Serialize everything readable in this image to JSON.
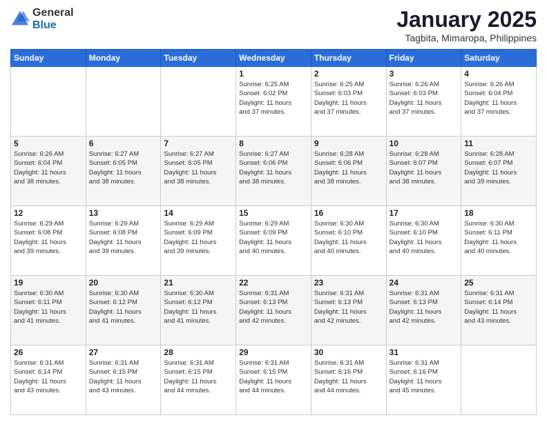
{
  "logo": {
    "general": "General",
    "blue": "Blue"
  },
  "header": {
    "title": "January 2025",
    "subtitle": "Tagbita, Mimaropa, Philippines"
  },
  "weekdays": [
    "Sunday",
    "Monday",
    "Tuesday",
    "Wednesday",
    "Thursday",
    "Friday",
    "Saturday"
  ],
  "weeks": [
    [
      {
        "day": "",
        "info": ""
      },
      {
        "day": "",
        "info": ""
      },
      {
        "day": "",
        "info": ""
      },
      {
        "day": "1",
        "info": "Sunrise: 6:25 AM\nSunset: 6:02 PM\nDaylight: 11 hours\nand 37 minutes."
      },
      {
        "day": "2",
        "info": "Sunrise: 6:25 AM\nSunset: 6:03 PM\nDaylight: 11 hours\nand 37 minutes."
      },
      {
        "day": "3",
        "info": "Sunrise: 6:26 AM\nSunset: 6:03 PM\nDaylight: 11 hours\nand 37 minutes."
      },
      {
        "day": "4",
        "info": "Sunrise: 6:26 AM\nSunset: 6:04 PM\nDaylight: 11 hours\nand 37 minutes."
      }
    ],
    [
      {
        "day": "5",
        "info": "Sunrise: 6:26 AM\nSunset: 6:04 PM\nDaylight: 11 hours\nand 38 minutes."
      },
      {
        "day": "6",
        "info": "Sunrise: 6:27 AM\nSunset: 6:05 PM\nDaylight: 11 hours\nand 38 minutes."
      },
      {
        "day": "7",
        "info": "Sunrise: 6:27 AM\nSunset: 6:05 PM\nDaylight: 11 hours\nand 38 minutes."
      },
      {
        "day": "8",
        "info": "Sunrise: 6:27 AM\nSunset: 6:06 PM\nDaylight: 11 hours\nand 38 minutes."
      },
      {
        "day": "9",
        "info": "Sunrise: 6:28 AM\nSunset: 6:06 PM\nDaylight: 11 hours\nand 38 minutes."
      },
      {
        "day": "10",
        "info": "Sunrise: 6:28 AM\nSunset: 6:07 PM\nDaylight: 11 hours\nand 38 minutes."
      },
      {
        "day": "11",
        "info": "Sunrise: 6:28 AM\nSunset: 6:07 PM\nDaylight: 11 hours\nand 39 minutes."
      }
    ],
    [
      {
        "day": "12",
        "info": "Sunrise: 6:29 AM\nSunset: 6:08 PM\nDaylight: 11 hours\nand 39 minutes."
      },
      {
        "day": "13",
        "info": "Sunrise: 6:29 AM\nSunset: 6:08 PM\nDaylight: 11 hours\nand 39 minutes."
      },
      {
        "day": "14",
        "info": "Sunrise: 6:29 AM\nSunset: 6:09 PM\nDaylight: 11 hours\nand 39 minutes."
      },
      {
        "day": "15",
        "info": "Sunrise: 6:29 AM\nSunset: 6:09 PM\nDaylight: 11 hours\nand 40 minutes."
      },
      {
        "day": "16",
        "info": "Sunrise: 6:30 AM\nSunset: 6:10 PM\nDaylight: 11 hours\nand 40 minutes."
      },
      {
        "day": "17",
        "info": "Sunrise: 6:30 AM\nSunset: 6:10 PM\nDaylight: 11 hours\nand 40 minutes."
      },
      {
        "day": "18",
        "info": "Sunrise: 6:30 AM\nSunset: 6:11 PM\nDaylight: 11 hours\nand 40 minutes."
      }
    ],
    [
      {
        "day": "19",
        "info": "Sunrise: 6:30 AM\nSunset: 6:11 PM\nDaylight: 11 hours\nand 41 minutes."
      },
      {
        "day": "20",
        "info": "Sunrise: 6:30 AM\nSunset: 6:12 PM\nDaylight: 11 hours\nand 41 minutes."
      },
      {
        "day": "21",
        "info": "Sunrise: 6:30 AM\nSunset: 6:12 PM\nDaylight: 11 hours\nand 41 minutes."
      },
      {
        "day": "22",
        "info": "Sunrise: 6:31 AM\nSunset: 6:13 PM\nDaylight: 11 hours\nand 42 minutes."
      },
      {
        "day": "23",
        "info": "Sunrise: 6:31 AM\nSunset: 6:13 PM\nDaylight: 11 hours\nand 42 minutes."
      },
      {
        "day": "24",
        "info": "Sunrise: 6:31 AM\nSunset: 6:13 PM\nDaylight: 11 hours\nand 42 minutes."
      },
      {
        "day": "25",
        "info": "Sunrise: 6:31 AM\nSunset: 6:14 PM\nDaylight: 11 hours\nand 43 minutes."
      }
    ],
    [
      {
        "day": "26",
        "info": "Sunrise: 6:31 AM\nSunset: 6:14 PM\nDaylight: 11 hours\nand 43 minutes."
      },
      {
        "day": "27",
        "info": "Sunrise: 6:31 AM\nSunset: 6:15 PM\nDaylight: 11 hours\nand 43 minutes."
      },
      {
        "day": "28",
        "info": "Sunrise: 6:31 AM\nSunset: 6:15 PM\nDaylight: 11 hours\nand 44 minutes."
      },
      {
        "day": "29",
        "info": "Sunrise: 6:31 AM\nSunset: 6:15 PM\nDaylight: 11 hours\nand 44 minutes."
      },
      {
        "day": "30",
        "info": "Sunrise: 6:31 AM\nSunset: 6:16 PM\nDaylight: 11 hours\nand 44 minutes."
      },
      {
        "day": "31",
        "info": "Sunrise: 6:31 AM\nSunset: 6:16 PM\nDaylight: 11 hours\nand 45 minutes."
      },
      {
        "day": "",
        "info": ""
      }
    ]
  ]
}
